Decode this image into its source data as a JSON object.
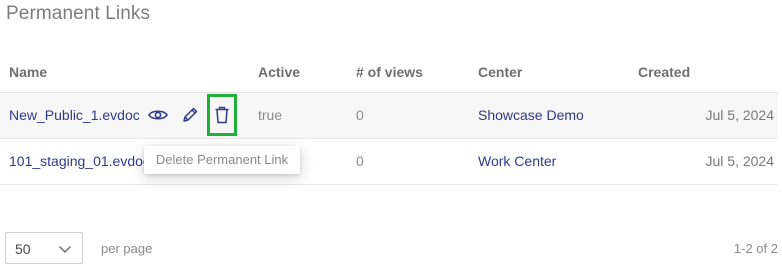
{
  "section_title": "Permanent Links",
  "columns": {
    "name": "Name",
    "active": "Active",
    "views": "# of views",
    "center": "Center",
    "created": "Created"
  },
  "rows": [
    {
      "name": "New_Public_1.evdoc",
      "active": "true",
      "views": "0",
      "center": "Showcase Demo",
      "created": "Jul 5, 2024"
    },
    {
      "name": "101_staging_01.evdoc",
      "active": "true",
      "views": "0",
      "center": "Work Center",
      "created": "Jul 5, 2024"
    }
  ],
  "row_actions": {
    "icons": [
      "eye-icon",
      "pencil-icon",
      "trash-icon"
    ]
  },
  "tooltip": "Delete Permanent Link",
  "pagination": {
    "page_size": "50",
    "per_page_label": "per page",
    "range": "1-2 of 2"
  },
  "colors": {
    "link": "#2e3a8c",
    "highlight_border": "#20b03a",
    "icon": "#2e3a8c"
  }
}
